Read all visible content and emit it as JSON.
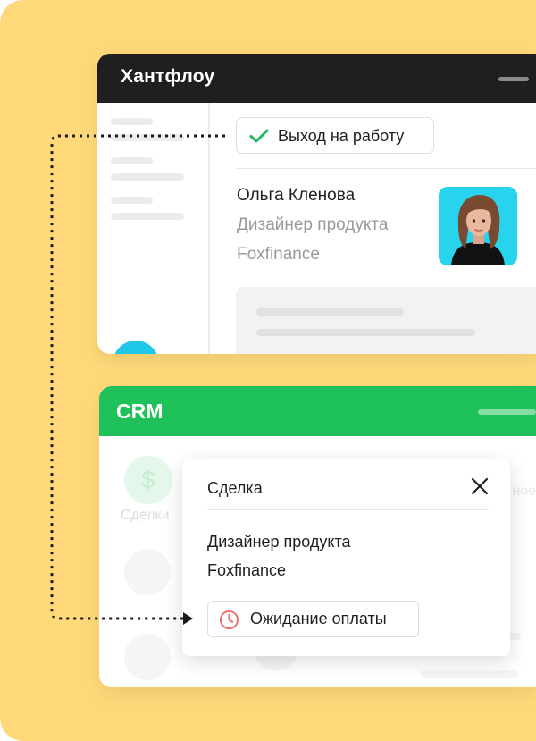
{
  "colors": {
    "background": "#ffd979",
    "huntflow_header": "#1f1f1f",
    "crm_header": "#1fc15a",
    "accent_cyan": "#1fc7e8",
    "check_green": "#20b85a",
    "clock_red": "#ef6b6b"
  },
  "huntflow": {
    "title": "Хантфлоу",
    "add_icon": "plus-icon",
    "status_chip": {
      "icon": "check-icon",
      "label": "Выход на работу"
    },
    "candidate": {
      "name": "Ольга Кленова",
      "role": "Дизайнер продукта",
      "company": "Foxfinance",
      "avatar": "avatar-photo"
    }
  },
  "crm": {
    "title": "CRM",
    "sidebar_item": {
      "icon": "dollar-icon",
      "label": "Сделки"
    }
  },
  "deal_popup": {
    "title": "Сделка",
    "close_icon": "close-icon",
    "role": "Дизайнер продукта",
    "company": "Foxfinance",
    "status": {
      "icon": "clock-icon",
      "label": "Ожидание оплаты"
    }
  }
}
